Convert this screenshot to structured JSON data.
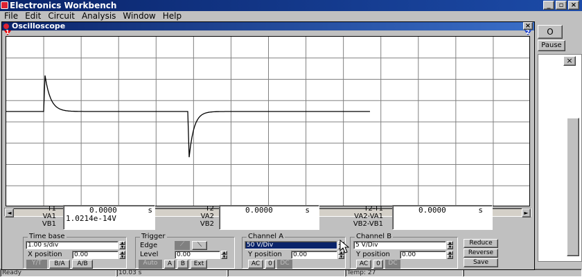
{
  "app": {
    "title": "Electronics Workbench",
    "window_buttons": [
      "_",
      "▫",
      "×"
    ]
  },
  "menubar": [
    "File",
    "Edit",
    "Circuit",
    "Analysis",
    "Window",
    "Help"
  ],
  "background": {
    "toolbar_label": "O",
    "pause_label": "Pause",
    "close_glyph": "×"
  },
  "status_bar": [
    "Ready",
    "10.03 s",
    "",
    "Temp: 27",
    ""
  ],
  "oscilloscope": {
    "title": "Oscilloscope",
    "close_glyph": "×",
    "marker_t1": "1",
    "marker_t2": "2",
    "scroll_left": "◄",
    "scroll_right": "►",
    "trace_color": "#000000",
    "grid_color": "#808080",
    "readouts": {
      "t1": {
        "labels": [
          "T1",
          "VA1",
          "VB1"
        ],
        "time": "0.0000",
        "time_unit": "s",
        "va": "1.0214e-14V",
        "vb": ""
      },
      "t2": {
        "labels": [
          "T2",
          "VA2",
          "VB2"
        ],
        "time": "0.0000",
        "time_unit": "s",
        "va": "",
        "vb": ""
      },
      "delta": {
        "labels": [
          "T2-T1",
          "VA2-VA1",
          "VB2-VB1"
        ],
        "time": "0.0000",
        "time_unit": "s",
        "va": "",
        "vb": ""
      }
    },
    "timebase": {
      "title": "Time base",
      "value": "1.00 s/div",
      "xpos_label": "X position",
      "xpos_value": "0.00",
      "modes": [
        "Y/T",
        "B/A",
        "A/B"
      ],
      "active_mode": "Y/T"
    },
    "trigger": {
      "title": "Trigger",
      "edge_label": "Edge",
      "edge_rise": "⟋",
      "edge_fall": "⟍",
      "level_label": "Level",
      "level_value": "0.00",
      "sources": [
        "Auto",
        "A",
        "B",
        "Ext"
      ]
    },
    "channel_a": {
      "title": "Channel A",
      "value": "50 V/Div",
      "ypos_label": "Y position",
      "ypos_value": "0.00",
      "coupling": [
        "AC",
        "0",
        "DC"
      ]
    },
    "channel_b": {
      "title": "Channel B",
      "value": "5 V/Div",
      "ypos_label": "Y position",
      "ypos_value": "0.00",
      "coupling": [
        "AC",
        "0",
        "DC"
      ]
    },
    "actions": [
      "Reduce",
      "Reverse",
      "Save"
    ]
  }
}
